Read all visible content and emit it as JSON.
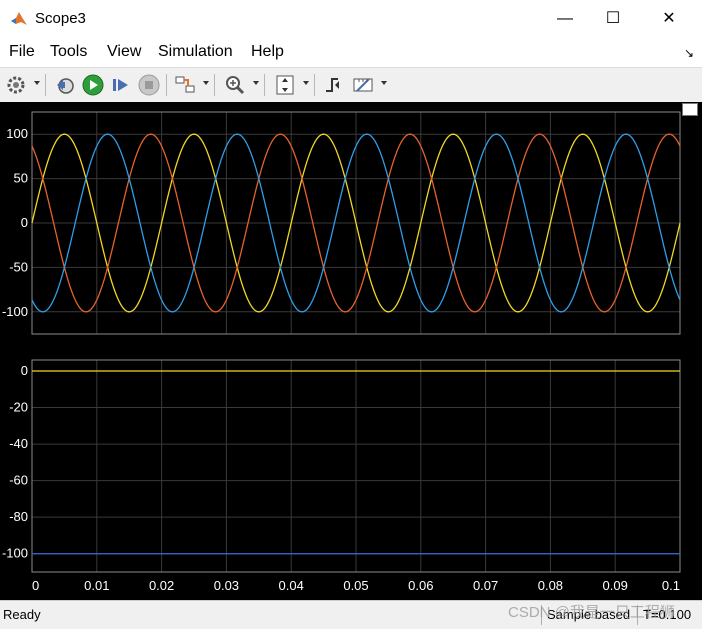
{
  "window": {
    "title": "Scope3",
    "minimize_glyph": "—",
    "maximize_glyph": "☐",
    "close_glyph": "✕"
  },
  "menu": {
    "items": [
      {
        "label": "File"
      },
      {
        "label": "Tools"
      },
      {
        "label": "View"
      },
      {
        "label": "Simulation"
      },
      {
        "label": "Help"
      }
    ]
  },
  "toolbar": {
    "buttons": [
      {
        "icon": "gear-icon"
      },
      {
        "icon": "step-back-icon"
      },
      {
        "icon": "run-icon",
        "color": "#2e9e3a"
      },
      {
        "icon": "step-forward-icon"
      },
      {
        "icon": "stop-icon"
      },
      {
        "icon": "highlight-signal-icon"
      },
      {
        "icon": "zoom-icon"
      },
      {
        "icon": "scale-axes-icon"
      },
      {
        "icon": "triggers-icon"
      },
      {
        "icon": "cursor-measurements-icon"
      }
    ]
  },
  "status": {
    "ready": "Ready",
    "mode": "Sample based",
    "time": "T=0.100"
  },
  "watermark": "CSDN @我是一只工程狮",
  "colors": {
    "background": "#000000",
    "axes_outline": "#8c8c8c",
    "grid": "#3a3a3a",
    "tick_label": "#ffffff"
  },
  "chart_data": [
    {
      "type": "line",
      "x_range": [
        0,
        0.1
      ],
      "ylim": [
        -125,
        125
      ],
      "y_ticks": [
        -100,
        -50,
        0,
        50,
        100
      ],
      "grid": true,
      "series": [
        {
          "color": "#f1d724",
          "amplitude": 100,
          "frequency": 50,
          "phase_deg": 0
        },
        {
          "color": "#e5622a",
          "amplitude": 100,
          "frequency": 50,
          "phase_deg": 120
        },
        {
          "color": "#2e9ee8",
          "amplitude": 100,
          "frequency": 50,
          "phase_deg": -120
        }
      ]
    },
    {
      "type": "line",
      "x_range": [
        0,
        0.1
      ],
      "ylim": [
        -110,
        6
      ],
      "y_ticks": [
        -100,
        -80,
        -60,
        -40,
        -20,
        0
      ],
      "x_ticks": [
        0,
        0.01,
        0.02,
        0.03,
        0.04,
        0.05,
        0.06,
        0.07,
        0.08,
        0.09,
        0.1
      ],
      "x_tick_labels": [
        "0",
        "0.01",
        "0.02",
        "0.03",
        "0.04",
        "0.05",
        "0.06",
        "0.07",
        "0.08",
        "0.09",
        "0.1"
      ],
      "grid": true,
      "series": [
        {
          "color": "#f1d724",
          "x": [
            0,
            0.1
          ],
          "y": [
            0,
            0
          ]
        },
        {
          "color": "#2e6ed6",
          "x": [
            0,
            0.1
          ],
          "y": [
            -100,
            -100
          ]
        }
      ]
    }
  ]
}
